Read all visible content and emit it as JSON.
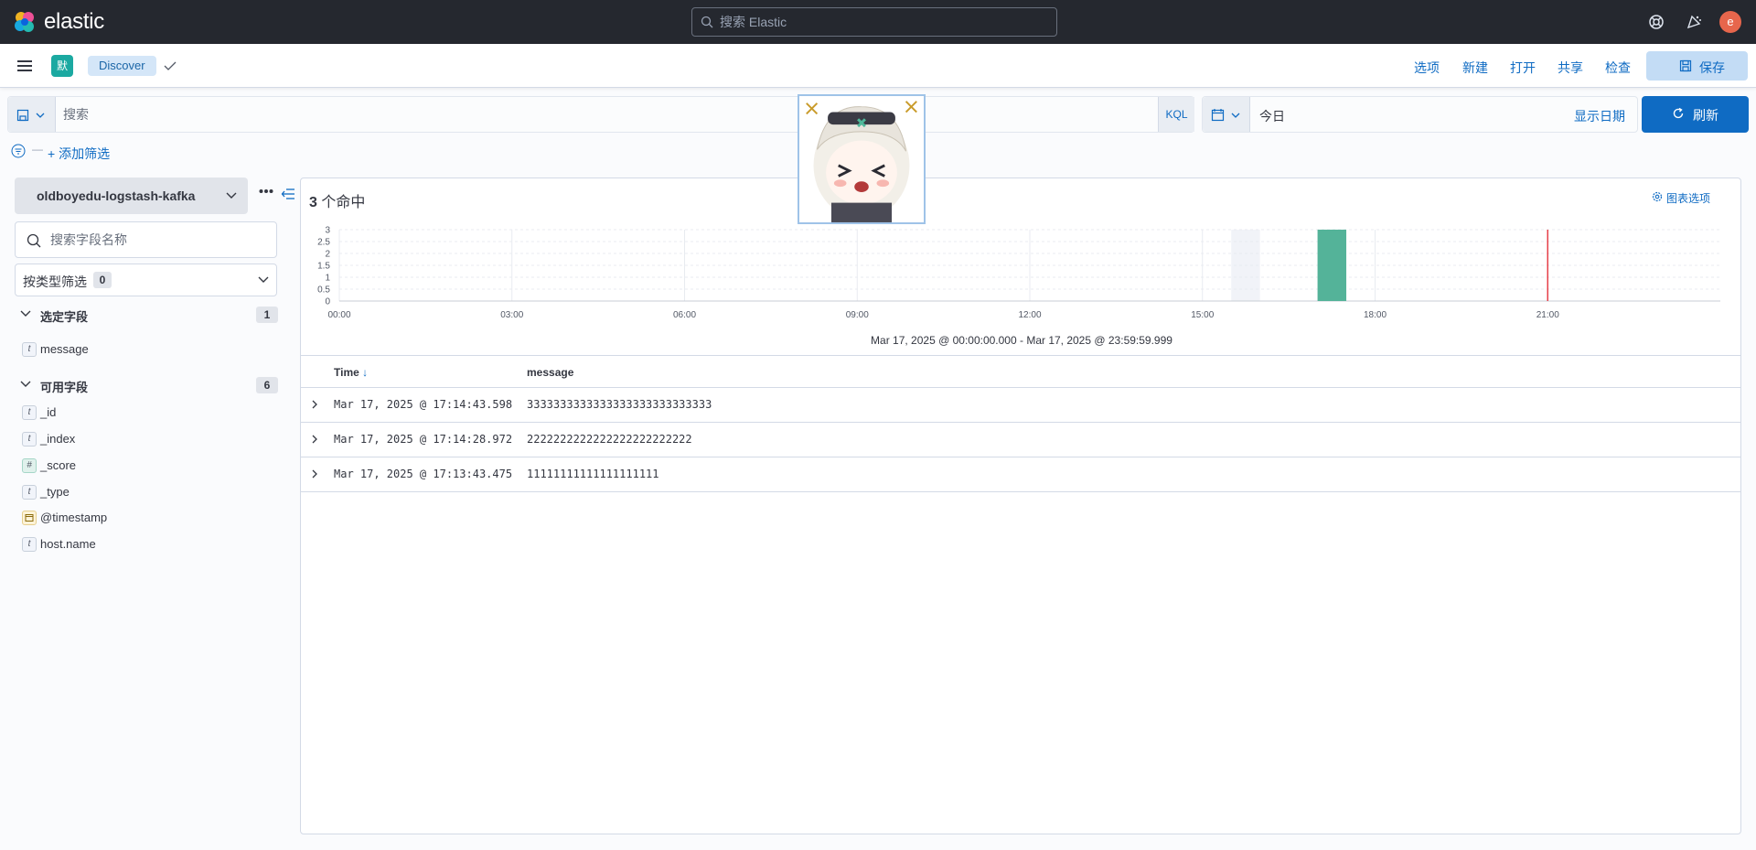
{
  "header": {
    "brand": "elastic",
    "search_placeholder": "搜索 Elastic",
    "avatar_initial": "e",
    "icons": [
      "help-icon",
      "newsfeed-icon"
    ]
  },
  "appbar": {
    "space_badge": "默",
    "breadcrumb": "Discover",
    "links": [
      "选项",
      "新建",
      "打开",
      "共享",
      "检查"
    ],
    "save_label": "保存"
  },
  "querybar": {
    "placeholder": "搜索",
    "language": "KQL",
    "date_value": "今日",
    "show_dates": "显示日期",
    "refresh_label": "刷新"
  },
  "filters": {
    "add_filter": "+ 添加筛选"
  },
  "sidebar": {
    "index_pattern": "oldboyedu-logstash-kafka",
    "field_search_placeholder": "搜索字段名称",
    "type_filter_label": "按类型筛选",
    "type_filter_count": "0",
    "selected_section": {
      "label": "选定字段",
      "count": "1"
    },
    "selected_fields": [
      {
        "type": "t",
        "name": "message"
      }
    ],
    "available_section": {
      "label": "可用字段",
      "count": "6"
    },
    "available_fields": [
      {
        "type": "t",
        "name": "_id"
      },
      {
        "type": "t",
        "name": "_index"
      },
      {
        "type": "#",
        "name": "_score"
      },
      {
        "type": "t",
        "name": "_type"
      },
      {
        "type": "cal",
        "name": "@timestamp"
      },
      {
        "type": "t",
        "name": "host.name"
      }
    ]
  },
  "results": {
    "hits_number": "3",
    "hits_suffix": " 个命中",
    "chart_options": "图表选项",
    "time_range": "Mar 17, 2025 @ 00:00:00.000 - Mar 17, 2025 @ 23:59:59.999",
    "columns": {
      "time": "Time",
      "time_sort": "↓",
      "message": "message"
    },
    "rows": [
      {
        "time": "Mar 17, 2025 @ 17:14:43.598",
        "message": "3333333333333333333333333333"
      },
      {
        "time": "Mar 17, 2025 @ 17:14:28.972",
        "message": "2222222222222222222222222"
      },
      {
        "time": "Mar 17, 2025 @ 17:13:43.475",
        "message": "11111111111111111111"
      }
    ]
  },
  "chart_data": {
    "type": "bar",
    "x_unit": "hours",
    "xlim": [
      0,
      24
    ],
    "ylim": [
      0,
      3
    ],
    "y_ticks": [
      "0",
      "0.5",
      "1",
      "1.5",
      "2",
      "2.5",
      "3"
    ],
    "x_ticks": [
      "00:00",
      "03:00",
      "06:00",
      "09:00",
      "12:00",
      "15:00",
      "18:00",
      "21:00"
    ],
    "bars": [
      {
        "start": 17.0,
        "end": 17.5,
        "value": 3
      }
    ],
    "bar_color": "#54b399",
    "current_time": 21.0,
    "current_time_color": "#e7404a",
    "highlight_range": [
      15.5,
      16.0
    ]
  }
}
